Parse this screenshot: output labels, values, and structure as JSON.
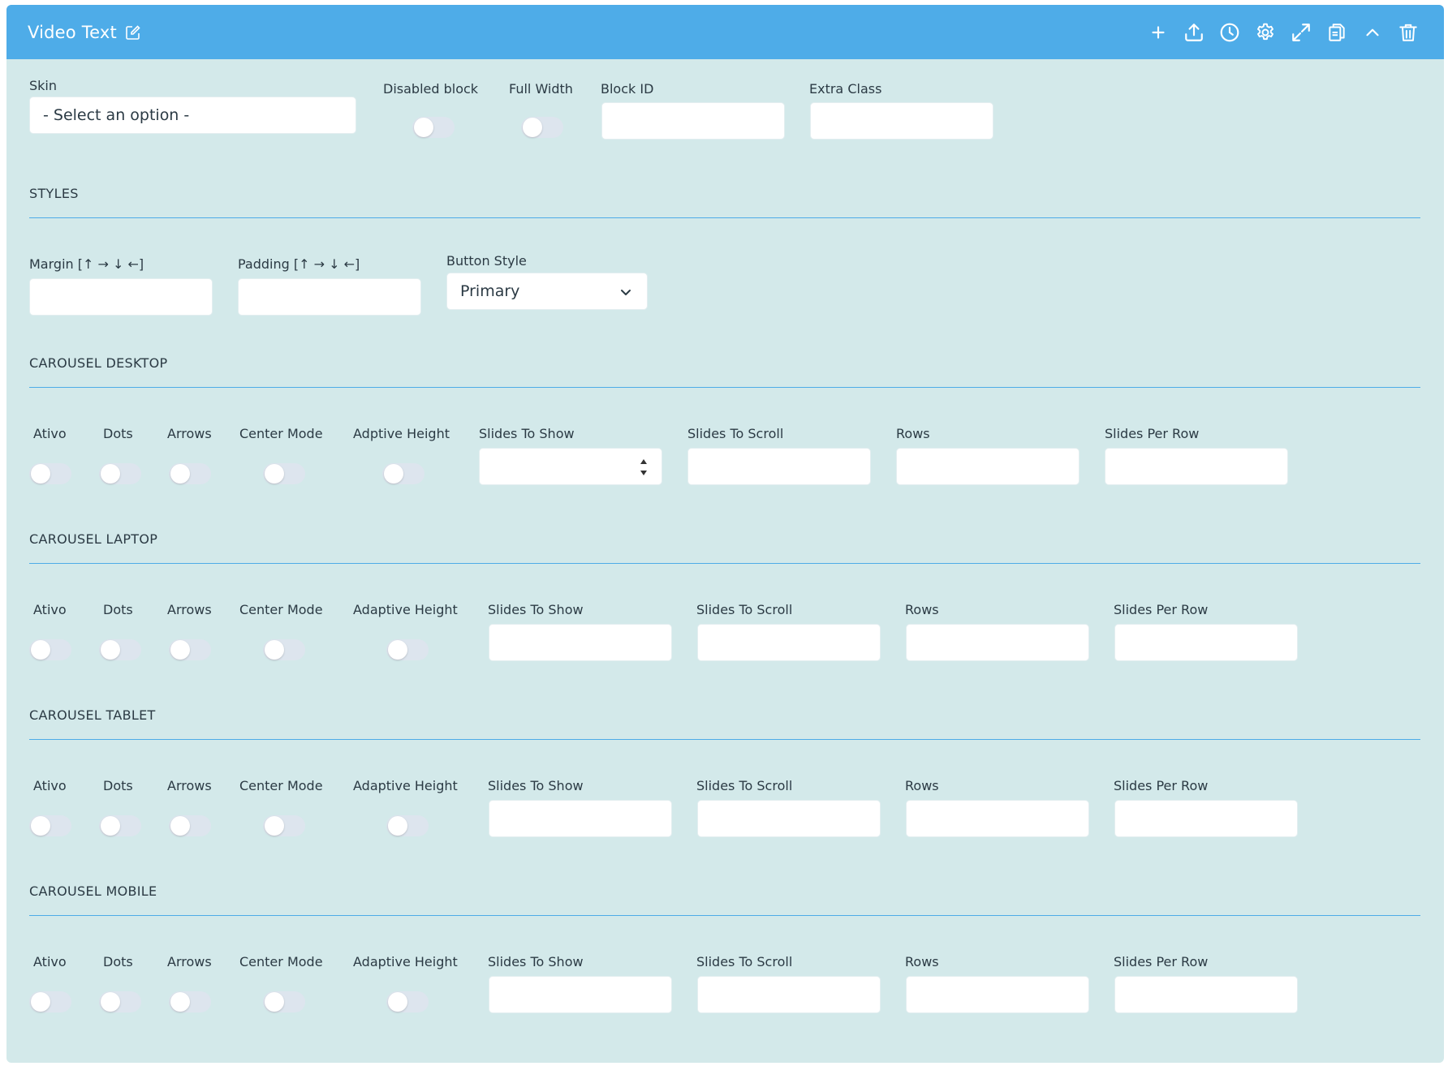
{
  "header": {
    "title": "Video Text",
    "tools": [
      "plus-icon",
      "upload-icon",
      "history-icon",
      "gear-icon",
      "expand-icon",
      "copy-icon",
      "chevron-up-icon",
      "trash-icon"
    ]
  },
  "general": {
    "skin_label": "Skin",
    "skin_value": "- Select an option -",
    "disabled_label": "Disabled block",
    "full_width_label": "Full Width",
    "block_id_label": "Block ID",
    "extra_class_label": "Extra Class"
  },
  "styles": {
    "title": "STYLES",
    "margin_label": "Margin [↑ → ↓ ←]",
    "padding_label": "Padding [↑ → ↓ ←]",
    "button_style_label": "Button Style",
    "button_style_value": "Primary"
  },
  "carousel_desktop": {
    "title": "CAROUSEL DESKTOP",
    "ativo": "Ativo",
    "dots": "Dots",
    "arrows": "Arrows",
    "center_mode": "Center Mode",
    "adaptive_height": "Adptive Height",
    "slides_to_show": "Slides To Show",
    "slides_to_scroll": "Slides To Scroll",
    "rows": "Rows",
    "slides_per_row": "Slides Per Row"
  },
  "carousel_laptop": {
    "title": "CAROUSEL LAPTOP",
    "ativo": "Ativo",
    "dots": "Dots",
    "arrows": "Arrows",
    "center_mode": "Center Mode",
    "adaptive_height": "Adaptive Height",
    "slides_to_show": "Slides To Show",
    "slides_to_scroll": "Slides To Scroll",
    "rows": "Rows",
    "slides_per_row": "Slides Per Row"
  },
  "carousel_tablet": {
    "title": "CAROUSEL TABLET",
    "ativo": "Ativo",
    "dots": "Dots",
    "arrows": "Arrows",
    "center_mode": "Center Mode",
    "adaptive_height": "Adaptive Height",
    "slides_to_show": "Slides To Show",
    "slides_to_scroll": "Slides To Scroll",
    "rows": "Rows",
    "slides_per_row": "Slides Per Row"
  },
  "carousel_mobile": {
    "title": "CAROUSEL MOBILE",
    "ativo": "Ativo",
    "dots": "Dots",
    "arrows": "Arrows",
    "center_mode": "Center Mode",
    "adaptive_height": "Adaptive Height",
    "slides_to_show": "Slides To Show",
    "slides_to_scroll": "Slides To Scroll",
    "rows": "Rows",
    "slides_per_row": "Slides Per Row"
  },
  "colors": {
    "header": "#4eace8",
    "panel": "#d3e9ea",
    "divider": "#4eace8",
    "toggle_off": "#dde5ee"
  }
}
